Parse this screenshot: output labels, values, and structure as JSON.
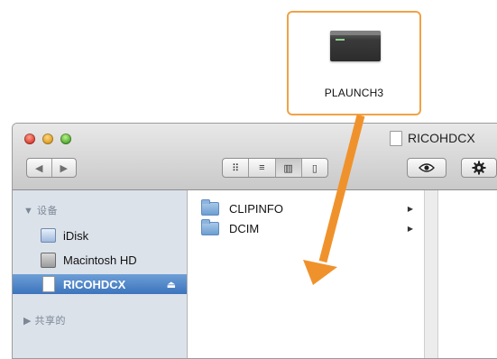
{
  "file": {
    "name": "PLAUNCH3",
    "icon": "executable-icon"
  },
  "window": {
    "title": "RICOHDCX",
    "traffic_lights": [
      "close",
      "minimize",
      "maximize"
    ],
    "nav": {
      "back": "◀",
      "forward": "▶"
    },
    "view_modes": [
      "icon",
      "list",
      "column",
      "coverflow"
    ],
    "view_glyphs": [
      "⠿",
      "≡",
      "▥",
      "▯"
    ],
    "active_view": "column",
    "quicklook_icon": "eye-icon",
    "action_icon": "gear-icon"
  },
  "sidebar": {
    "sections": [
      {
        "header": "▼ 设备",
        "items": [
          {
            "label": "iDisk",
            "icon": "idisk-icon"
          },
          {
            "label": "Macintosh HD",
            "icon": "hard-drive-icon"
          },
          {
            "label": "RICOHDCX",
            "icon": "sd-card-icon",
            "selected": true,
            "eject": "⏏"
          }
        ]
      },
      {
        "header": "▶ 共享的",
        "items": []
      }
    ]
  },
  "column1": {
    "items": [
      {
        "label": "CLIPINFO",
        "icon": "folder-icon",
        "has_children": true
      },
      {
        "label": "DCIM",
        "icon": "folder-icon",
        "has_children": true
      }
    ]
  },
  "colors": {
    "highlight": "#f0a248",
    "selection": "#3c74bd",
    "sidebar_bg": "#dce2ea"
  }
}
